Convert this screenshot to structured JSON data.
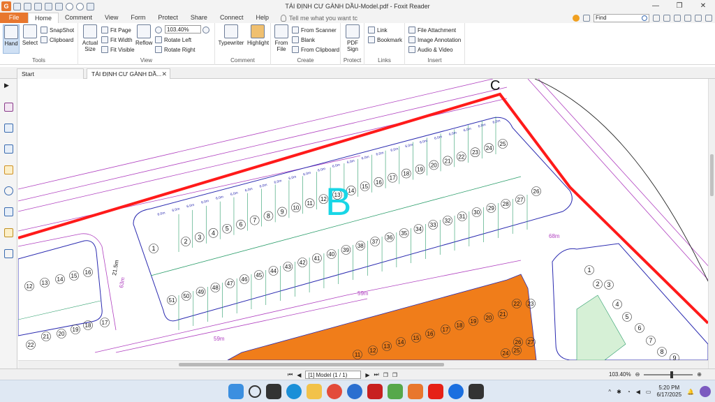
{
  "window": {
    "title": "TÁI ĐỊNH CƯ GÀNH DẦU-Model.pdf - Foxit Reader",
    "minimize": "—",
    "restore": "❐",
    "close": "✕"
  },
  "ribbon_tabs": {
    "file": "File",
    "tabs": [
      "Home",
      "Comment",
      "View",
      "Form",
      "Protect",
      "Share",
      "Connect",
      "Help"
    ],
    "active": "Home",
    "tell_me": "Tell me what you want tc",
    "find_placeholder": "Find"
  },
  "ribbon": {
    "tools": {
      "label": "Tools",
      "hand": "Hand",
      "select": "Select",
      "snapshot": "SnapShot",
      "clipboard": "Clipboard"
    },
    "view": {
      "label": "View",
      "actual_size_1": "Actual",
      "actual_size_2": "Size",
      "fit_page": "Fit Page",
      "fit_width": "Fit Width",
      "fit_visible": "Fit Visible",
      "reflow": "Reflow",
      "zoom": "103.40%",
      "rotate_left": "Rotate Left",
      "rotate_right": "Rotate Right"
    },
    "comment": {
      "label": "Comment",
      "typewriter": "Typewriter",
      "highlight": "Highlight"
    },
    "create": {
      "label": "Create",
      "from_file_1": "From",
      "from_file_2": "File",
      "from_scanner": "From Scanner",
      "blank": "Blank",
      "from_clipboard": "From Clipboard"
    },
    "protect": {
      "label": "Protect",
      "pdf_sign_1": "PDF",
      "pdf_sign_2": "Sign"
    },
    "links": {
      "label": "Links",
      "link": "Link",
      "bookmark": "Bookmark"
    },
    "insert": {
      "label": "Insert",
      "file_attachment": "File Attachment",
      "image_annotation": "Image Annotation",
      "audio_video": "Audio & Video"
    }
  },
  "doc_tabs": {
    "start": "Start",
    "doc": "TÁI ĐỊNH CƯ GÀNH DẦ...",
    "close": "✕"
  },
  "drawing": {
    "block_letter": "B",
    "corner_letter": "C",
    "dim_59m": "59m",
    "dim_68m": "68m",
    "dim_63m": "63m",
    "dim_215m": "21.5m",
    "dim_6": "6.0m",
    "row_top": [
      "2",
      "3",
      "4",
      "5",
      "6",
      "7",
      "8",
      "9",
      "10",
      "11",
      "12",
      "13",
      "14",
      "15",
      "16",
      "17",
      "18",
      "19",
      "20",
      "21",
      "22",
      "23",
      "24",
      "25"
    ],
    "row_mid": [
      "1",
      "26",
      "27",
      "28",
      "29",
      "30",
      "31",
      "32",
      "33",
      "34",
      "35",
      "36",
      "37",
      "38",
      "39",
      "40",
      "41",
      "42",
      "43",
      "44",
      "45",
      "46",
      "47",
      "48",
      "49",
      "50",
      "51"
    ],
    "left_block": [
      "12",
      "13",
      "14",
      "15",
      "16",
      "22",
      "21",
      "20",
      "19",
      "18",
      "17"
    ],
    "orange_block": [
      "11",
      "12",
      "13",
      "14",
      "15",
      "16",
      "17",
      "18",
      "19",
      "20",
      "21",
      "22",
      "23",
      "24",
      "25",
      "26",
      "27"
    ],
    "right_block": [
      "1",
      "2",
      "3",
      "4",
      "5",
      "6",
      "7",
      "8",
      "9"
    ]
  },
  "statusbar": {
    "page": "[1] Model (1 / 1)",
    "zoom": "103.40%"
  },
  "taskbar": {
    "time": "5:20 PM",
    "date": "6/17/2025"
  },
  "colors": {
    "accent": "#e8772e",
    "red_line": "#ff1a1a",
    "parcel_line": "#2a9d6a",
    "boundary_blue": "#2a2ab0",
    "magenta": "#b040c0",
    "block_letter": "#19d6e6",
    "orange_fill": "#f07d1a"
  }
}
